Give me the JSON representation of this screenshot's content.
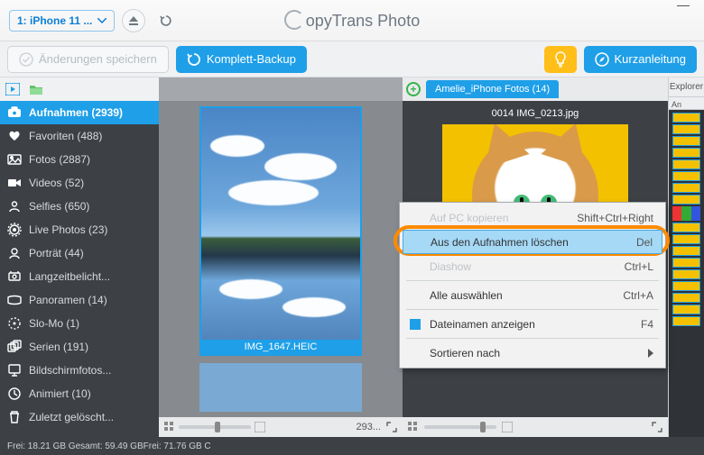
{
  "titlebar": {
    "device_label": "1: iPhone 11 ...",
    "app_name_rest": "opyTrans Photo"
  },
  "toolbar": {
    "save_label": "Änderungen speichern",
    "backup_label": "Komplett-Backup",
    "guide_label": "Kurzanleitung"
  },
  "sidebar": {
    "items": [
      {
        "icon": "camera",
        "label": "Aufnahmen (2939)",
        "active": true
      },
      {
        "icon": "heart",
        "label": "Favoriten (488)"
      },
      {
        "icon": "photo",
        "label": "Fotos (2887)"
      },
      {
        "icon": "video",
        "label": "Videos (52)"
      },
      {
        "icon": "selfie",
        "label": "Selfies (650)"
      },
      {
        "icon": "live",
        "label": "Live Photos (23)"
      },
      {
        "icon": "portrait",
        "label": "Porträt (44)"
      },
      {
        "icon": "longexp",
        "label": "Langzeitbelicht..."
      },
      {
        "icon": "pano",
        "label": "Panoramen (14)"
      },
      {
        "icon": "slomo",
        "label": "Slo-Mo (1)"
      },
      {
        "icon": "burst",
        "label": "Serien (191)"
      },
      {
        "icon": "screenshot",
        "label": "Bildschirmfotos..."
      },
      {
        "icon": "animated",
        "label": "Animiert (10)"
      },
      {
        "icon": "trash",
        "label": "Zuletzt gelöscht..."
      }
    ]
  },
  "center": {
    "selected_label": "IMG_1647.HEIC",
    "count_display": "293..."
  },
  "right": {
    "tab_label": "Amelie_iPhone Fotos (14)",
    "image_label": "0014 IMG_0213.jpg",
    "explorer_label": "Explorer",
    "strip_label": "An"
  },
  "context_menu": {
    "items": [
      {
        "label": "Auf PC kopieren",
        "shortcut": "Shift+Ctrl+Right",
        "dim": true
      },
      {
        "label": "Aus den Aufnahmen löschen",
        "shortcut": "Del",
        "hl": true
      },
      {
        "label": "Diashow",
        "shortcut": "Ctrl+L",
        "dim": true
      },
      {
        "label": "Alle auswählen",
        "shortcut": "Ctrl+A"
      },
      {
        "label": "Dateinamen anzeigen",
        "shortcut": "F4",
        "check": true
      },
      {
        "label": "Sortieren nach",
        "arrow": true
      }
    ]
  },
  "status": {
    "left_text": "Frei: 18.21 GB Gesamt: 59.49 GB",
    "right_text": "Frei: 71.76 GB C"
  }
}
